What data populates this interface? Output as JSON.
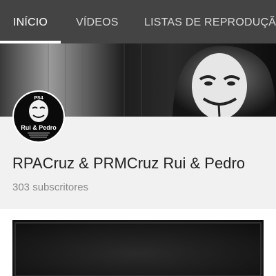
{
  "tabs": [
    {
      "label": "INÍCIO",
      "active": true
    },
    {
      "label": "VÍDEOS",
      "active": false
    },
    {
      "label": "LISTAS DE REPRODUÇÃO",
      "active": false
    }
  ],
  "colors": {
    "tabbar_bg": "#444444",
    "page_bg": "#f1f1f1",
    "title_text": "#212121",
    "subtitle_text": "#8a8a8a"
  },
  "avatar": {
    "badge_top": "PS4",
    "name": "Rui & Pedro"
  },
  "channel": {
    "name": "RPACruz & PRMCruz Rui & Pedro",
    "subscribers": "303 subscritores"
  }
}
